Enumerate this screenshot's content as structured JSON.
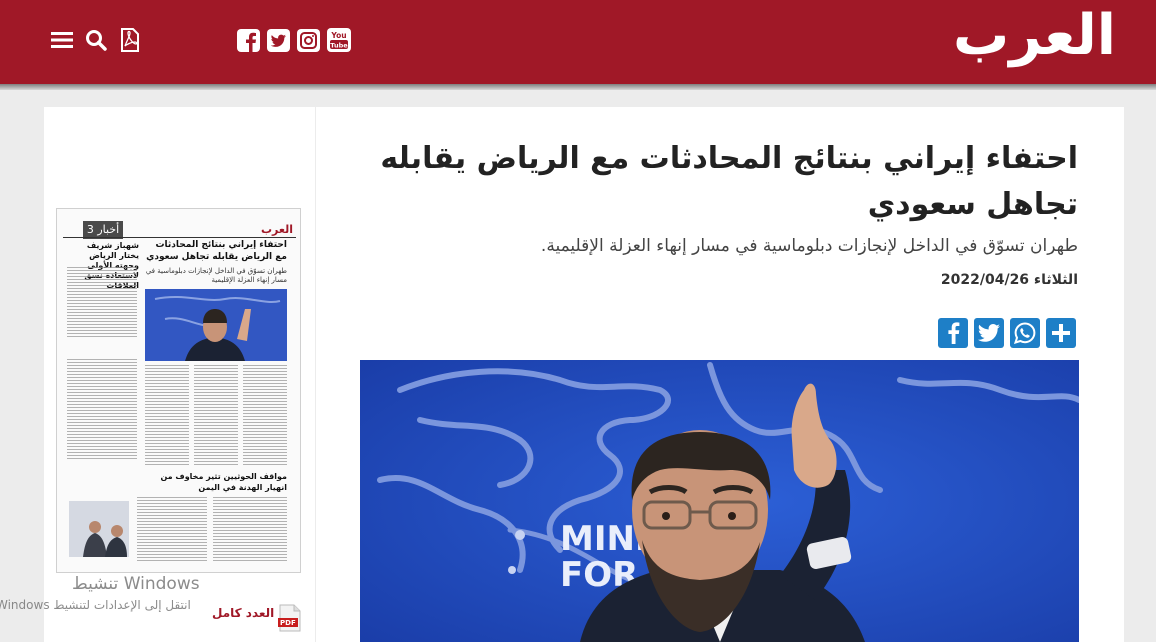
{
  "header": {
    "logo_text": "العرب",
    "brand_color": "#a01827",
    "left_icons": [
      "menu-icon",
      "search-icon",
      "pdf-icon"
    ],
    "social_icons": [
      "facebook-icon",
      "twitter-icon",
      "instagram-icon",
      "youtube-icon"
    ]
  },
  "article": {
    "title": "احتفاء إيراني بنتائج المحادثات مع الرياض يقابله تجاهل سعودي",
    "subtitle": "طهران تسوّق في الداخل لإنجازات دبلوماسية في مسار إنهاء العزلة الإقليمية.",
    "date": "الثلاثاء 2022/04/26",
    "share_icons": [
      "facebook-icon",
      "twitter-icon",
      "whatsapp-icon",
      "share-icon"
    ],
    "photo_sign_text": "MINIS\nFOR",
    "photo_sign_right": "R"
  },
  "sidebar": {
    "paper_logo": "العرب",
    "section_label": "أخبار 3",
    "lead_headline": "احتفاء إيراني بنتائج المحادثات مع الرياض يقابله تجاهل سعودي",
    "lead_sub": "طهران تسوّق في الداخل لإنجازات دبلوماسية في مسار إنهاء العزلة الإقليمية",
    "side_headline": "شهباز شريف يختار الرياض وجهته الأولى لاستعادة نسق العلاقات",
    "bottom_headline": "مواقف الحوثيين تثير مخاوف من انهيار الهدنة في اليمن",
    "full_issue_label": "العدد كامل",
    "pdf_label": "PDF"
  },
  "watermark": {
    "title": "تنشيط Windows",
    "subtitle": "انتقل إلى الإعدادات لتنشيط Windows"
  }
}
